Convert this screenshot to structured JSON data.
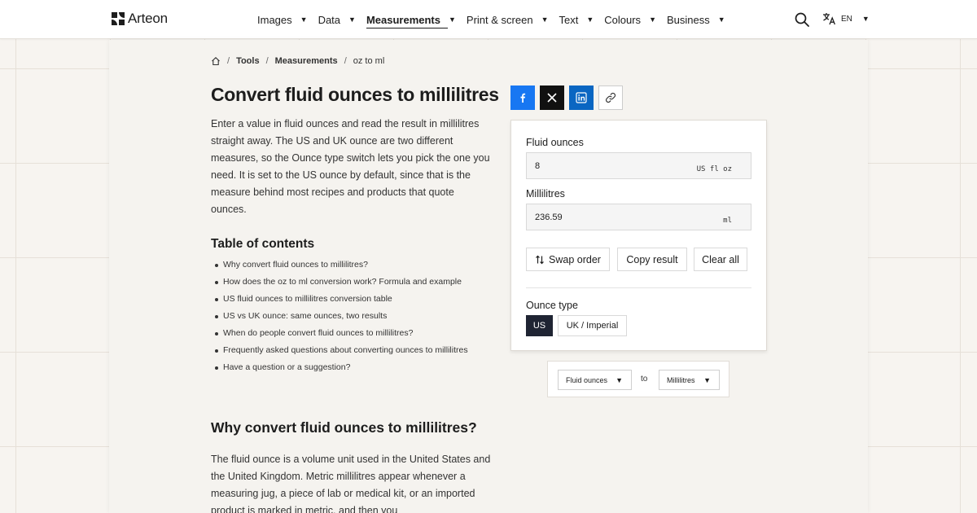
{
  "header": {
    "brand": "Arteon",
    "nav": [
      {
        "label": "Images",
        "active": false
      },
      {
        "label": "Data",
        "active": false
      },
      {
        "label": "Measurements",
        "active": true
      },
      {
        "label": "Print & screen",
        "active": false
      },
      {
        "label": "Text",
        "active": false
      },
      {
        "label": "Colours",
        "active": false
      },
      {
        "label": "Business",
        "active": false
      }
    ],
    "language": "EN"
  },
  "breadcrumb": {
    "items": [
      "Tools",
      "Measurements",
      "oz to ml"
    ]
  },
  "page": {
    "title": "Convert fluid ounces to millilitres",
    "intro": "Enter a value in fluid ounces and read the result in millilitres straight away. The US and UK ounce are two different measures, so the Ounce type switch lets you pick the one you need. It is set to the US ounce by default, since that is the measure behind most recipes and products that quote ounces.",
    "toc_title": "Table of contents",
    "toc": [
      "Why convert fluid ounces to millilitres?",
      "How does the oz to ml conversion work? Formula and example",
      "US fluid ounces to millilitres conversion table",
      "US vs UK ounce: same ounces, two results",
      "When do people convert fluid ounces to millilitres?",
      "Frequently asked questions about converting ounces to millilitres",
      "Have a question or a suggestion?"
    ],
    "section_title": "Why convert fluid ounces to millilitres?",
    "section_text": "The fluid ounce is a volume unit used in the United States and the United Kingdom. Metric millilitres appear whenever a measuring jug, a piece of lab or medical kit, or an imported product is marked in metric, and then you"
  },
  "converter": {
    "from_label": "Fluid ounces",
    "from_value": "8",
    "from_unit": "US fl oz",
    "to_label": "Millilitres",
    "to_value": "236.59",
    "to_unit": "ml",
    "swap_label": "Swap order",
    "copy_label": "Copy result",
    "clear_label": "Clear all",
    "ounce_type_label": "Ounce type",
    "ounce_types": [
      "US",
      "UK / Imperial"
    ],
    "ounce_type_selected": "US"
  },
  "unit_select": {
    "from": "Fluid ounces",
    "to_word": "to",
    "to": "Millilitres"
  },
  "colors": {
    "facebook": "#1877f2",
    "x": "#111111",
    "linkedin": "#0a66c2",
    "segment_active": "#1f2433"
  }
}
